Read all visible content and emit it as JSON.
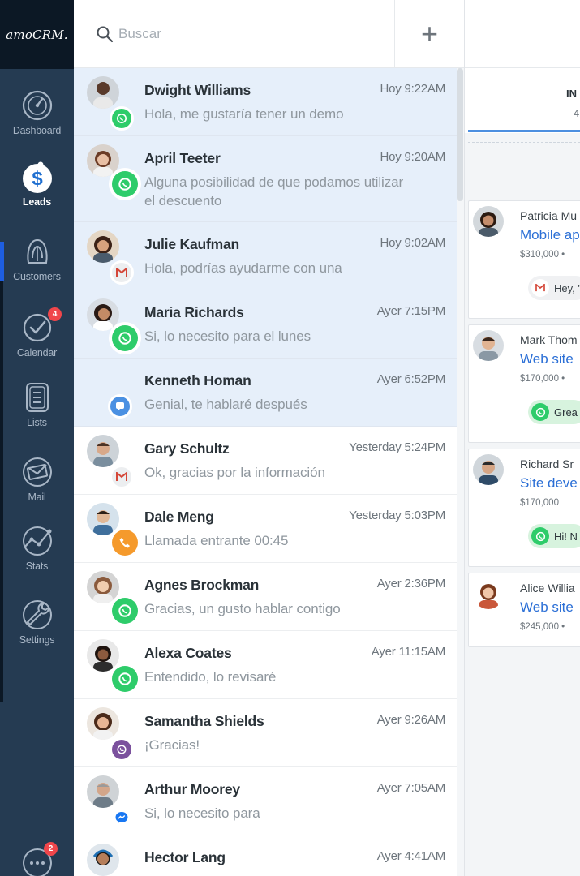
{
  "brand": {
    "logo_text": "amoCRM."
  },
  "colors": {
    "sidebar_bg": "#253b52",
    "logo_bg": "#0c1825",
    "unread_bg": "#e6effa",
    "whatsapp": "#2ecc6a",
    "gmail": "#d44638",
    "viber": "#7b519d",
    "messenger": "#1877f2",
    "chat": "#4a90e2",
    "phone": "#f59a2c",
    "badge": "#f0464b",
    "link": "#2b6fd6"
  },
  "sidebar": {
    "items": [
      {
        "label": "Dashboard",
        "icon": "speedometer-icon",
        "active": false
      },
      {
        "label": "Leads",
        "icon": "dollar-leads-icon",
        "active": true
      },
      {
        "label": "Customers",
        "icon": "customers-icon",
        "active": false
      },
      {
        "label": "Calendar",
        "icon": "checkmark-calendar-icon",
        "active": false,
        "badge": "4"
      },
      {
        "label": "Lists",
        "icon": "list-icon",
        "active": false
      },
      {
        "label": "Mail",
        "icon": "mail-icon",
        "active": false
      },
      {
        "label": "Stats",
        "icon": "stats-icon",
        "active": false
      },
      {
        "label": "Settings",
        "icon": "wrench-icon",
        "active": false
      }
    ],
    "chat_badge": "2"
  },
  "search": {
    "placeholder": "Buscar",
    "value": ""
  },
  "add_button": {
    "label": "+"
  },
  "conversations": [
    {
      "name": "Dwight Williams",
      "time": "Hoy 9:22AM",
      "message": "Hola, me gustaría tener un demo",
      "channel": "whatsapp",
      "unread": true
    },
    {
      "name": "April Teeter",
      "time": "Hoy 9:20AM",
      "message": "Alguna posibilidad de que podamos utilizar el descuento",
      "channel": "whatsapp",
      "unread": true
    },
    {
      "name": "Julie Kaufman",
      "time": "Hoy 9:02AM",
      "message": "Hola, podrías ayudarme con una",
      "channel": "gmail",
      "unread": true
    },
    {
      "name": "Maria Richards",
      "time": "Ayer 7:15PM",
      "message": "Si, lo necesito para el lunes",
      "channel": "whatsapp",
      "unread": true
    },
    {
      "name": "Kenneth Homan",
      "time": "Ayer 6:52PM",
      "message": "Genial, te hablaré después",
      "channel": "chat",
      "unread": true
    },
    {
      "name": "Gary Schultz",
      "time": "Yesterday 5:24PM",
      "message": "Ok, gracias por la información",
      "channel": "gmail",
      "unread": false
    },
    {
      "name": "Dale Meng",
      "time": "Yesterday 5:03PM",
      "message": "Llamada entrante 00:45",
      "channel": "phone",
      "unread": false
    },
    {
      "name": "Agnes Brockman",
      "time": "Ayer 2:36PM",
      "message": "Gracias, un gusto hablar contigo",
      "channel": "whatsapp",
      "unread": false
    },
    {
      "name": "Alexa Coates",
      "time": "Ayer 11:15AM",
      "message": "Entendido, lo revisaré",
      "channel": "whatsapp",
      "unread": false
    },
    {
      "name": "Samantha Shields",
      "time": "Ayer 9:26AM",
      "message": "¡Gracias!",
      "channel": "viber",
      "unread": false
    },
    {
      "name": "Arthur Moorey",
      "time": "Ayer 7:05AM",
      "message": "Si, lo necesito para",
      "channel": "messenger",
      "unread": false
    },
    {
      "name": "Hector Lang",
      "time": "Ayer 4:41AM",
      "message": "",
      "channel": "",
      "unread": false
    }
  ],
  "pipeline": {
    "stage_title": "IN",
    "stage_count": "4",
    "leads": [
      {
        "contact": "Patricia Mu",
        "title": "Mobile ap",
        "price": "$310,000 •",
        "chip": "Hey, '",
        "chip_channel": "gmail"
      },
      {
        "contact": "Mark Thom",
        "title": "Web site",
        "price": "$170,000 •",
        "chip": "Grea",
        "chip_channel": "whatsapp"
      },
      {
        "contact": "Richard Sr",
        "title": "Site deve",
        "price": "$170,000",
        "chip": "Hi! N",
        "chip_channel": "whatsapp"
      },
      {
        "contact": "Alice Willia",
        "title": "Web site",
        "price": "$245,000 •",
        "chip": "",
        "chip_channel": ""
      }
    ]
  }
}
